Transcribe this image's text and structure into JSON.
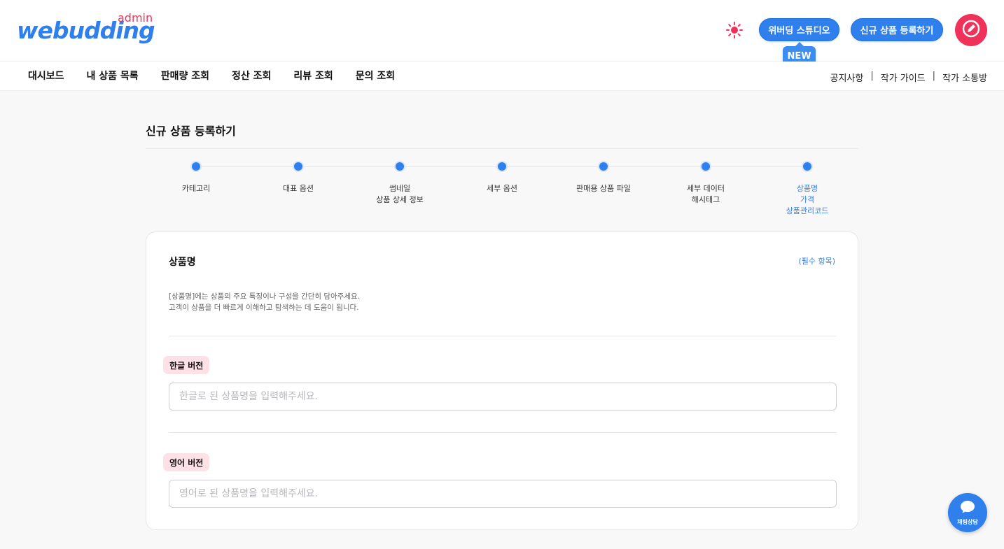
{
  "header": {
    "logo_text": "webudding",
    "logo_sub": "admin",
    "studio_button": "위버딩 스튜디오",
    "new_badge": "NEW",
    "register_button": "신규 상품 등록하기",
    "theme_icon": "sun-icon",
    "avatar_icon": "pencil-circle-icon"
  },
  "nav": {
    "items": [
      "대시보드",
      "내 상품 목록",
      "판매량 조회",
      "정산 조회",
      "리뷰 조회",
      "문의 조회"
    ],
    "right_links": [
      "공지사항",
      "작가 가이드",
      "작가 소통방"
    ],
    "separator": "|"
  },
  "page": {
    "title": "신규 상품 등록하기"
  },
  "stepper": {
    "steps": [
      {
        "label": "카테고리"
      },
      {
        "label": "대표 옵션"
      },
      {
        "label": "썸네일\n상품 상세 정보"
      },
      {
        "label": "세부 옵션"
      },
      {
        "label": "판매용 상품 파일"
      },
      {
        "label": "세부 데이터\n해시태그"
      },
      {
        "label": "상품명\n가격\n상품관리코드"
      }
    ],
    "active_index": 6
  },
  "card": {
    "title": "상품명",
    "required_label": "(필수 항목)",
    "description_line1": "[상품명]에는 상품의 주요 특징이나 구성을 간단히 담아주세요.",
    "description_line2": "고객이 상품을 더 빠르게 이해하고 탐색하는 데 도움이 됩니다.",
    "korean_tag": "한글 버전",
    "korean_placeholder": "한글로 된 상품명을 입력해주세요.",
    "korean_value": "",
    "english_tag": "영어 버전",
    "english_placeholder": "영어로 된 상품명을 입력해주세요.",
    "english_value": ""
  },
  "chat": {
    "label": "채팅상담",
    "icon": "chat-bubble-icon"
  },
  "colors": {
    "brand_blue": "#2f80ed",
    "brand_pink": "#f0325a",
    "tag_pink": "#fde1e6"
  }
}
